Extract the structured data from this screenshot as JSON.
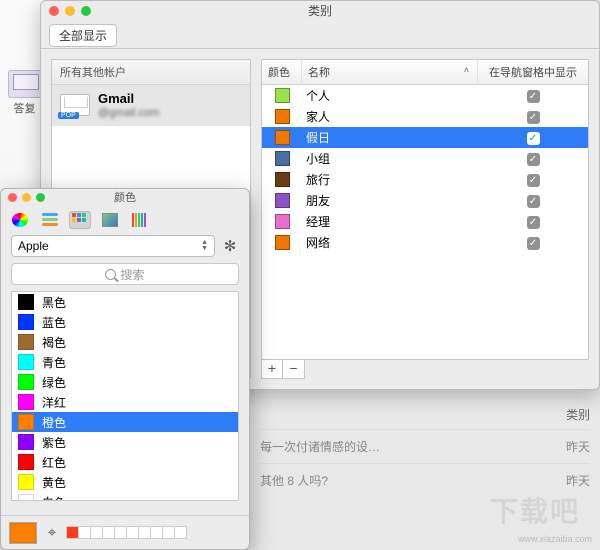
{
  "bg": {
    "reply_label": "答复"
  },
  "cat_window": {
    "title": "类别",
    "show_all": "全部显示",
    "accounts_header": "所有其他帐户",
    "account": {
      "name": "Gmail",
      "email": "@gmail.com",
      "badge": "POP"
    },
    "columns": {
      "color": "颜色",
      "name": "名称",
      "show": "在导航窗格中显示"
    },
    "rows": [
      {
        "color": "#9de04e",
        "name": "个人",
        "checked": true,
        "selected": false
      },
      {
        "color": "#f07800",
        "name": "家人",
        "checked": true,
        "selected": false
      },
      {
        "color": "#f07800",
        "name": "假日",
        "checked": true,
        "selected": true
      },
      {
        "color": "#4a6ea0",
        "name": "小组",
        "checked": true,
        "selected": false
      },
      {
        "color": "#6a3c16",
        "name": "旅行",
        "checked": true,
        "selected": false
      },
      {
        "color": "#8d52c5",
        "name": "朋友",
        "checked": true,
        "selected": false
      },
      {
        "color": "#e96fcf",
        "name": "经理",
        "checked": true,
        "selected": false
      },
      {
        "color": "#f07800",
        "name": "网络",
        "checked": true,
        "selected": false
      }
    ],
    "add": "+",
    "remove": "−",
    "footer_label": "类别"
  },
  "picker": {
    "title": "颜色",
    "palette_name": "Apple",
    "gear": "✻",
    "search_placeholder": "搜索",
    "colors": [
      {
        "hex": "#000000",
        "name": "黑色",
        "selected": false
      },
      {
        "hex": "#0036ff",
        "name": "蓝色",
        "selected": false
      },
      {
        "hex": "#9b6a2f",
        "name": "褐色",
        "selected": false
      },
      {
        "hex": "#00ffff",
        "name": "青色",
        "selected": false
      },
      {
        "hex": "#00ff00",
        "name": "绿色",
        "selected": false
      },
      {
        "hex": "#ff00ff",
        "name": "洋红",
        "selected": false
      },
      {
        "hex": "#ff8000",
        "name": "橙色",
        "selected": true
      },
      {
        "hex": "#9000ff",
        "name": "紫色",
        "selected": false
      },
      {
        "hex": "#ff0000",
        "name": "红色",
        "selected": false
      },
      {
        "hex": "#ffff00",
        "name": "黄色",
        "selected": false
      },
      {
        "hex": "#ffffff",
        "name": "白色",
        "selected": false
      }
    ],
    "current_hex": "#ff8000",
    "recent_hex": "#ff3b1f"
  },
  "behind": {
    "line1_left": "每一次付诸情感的设…",
    "line1_right": "昨天",
    "line2_left": "其他 8 人吗?",
    "line2_right": "昨天"
  },
  "watermark": {
    "logo": "下载吧",
    "url": "www.xiazaiba.com"
  }
}
